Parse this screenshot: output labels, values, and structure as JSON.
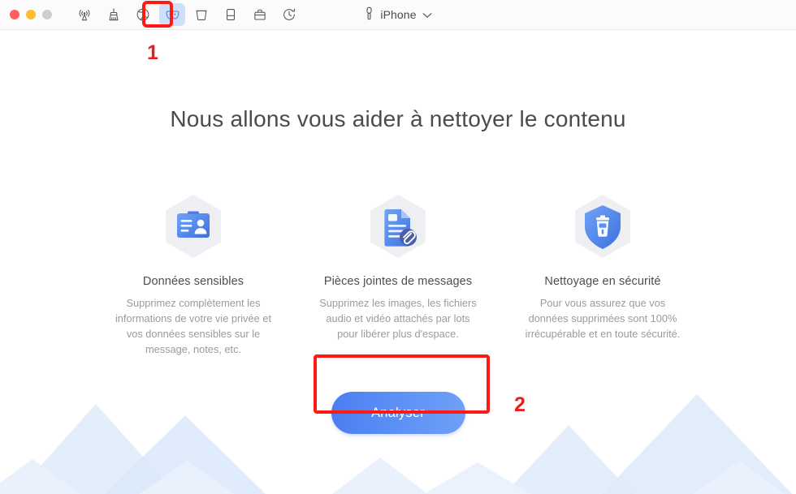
{
  "window": {
    "traffic_lights": [
      {
        "name": "close",
        "color": "#ff5f57"
      },
      {
        "name": "minimize",
        "color": "#febc2e"
      },
      {
        "name": "zoom",
        "color": "#cfcfcf"
      }
    ],
    "toolbar": {
      "items": [
        {
          "icon": "airdrop-transfer-icon",
          "label": "Transfert",
          "active": false
        },
        {
          "icon": "broom-cleaner-icon",
          "label": "Nettoyage",
          "active": false
        },
        {
          "icon": "globe-eraser-icon",
          "label": "Effacement",
          "active": false
        },
        {
          "icon": "privacy-mask-icon",
          "label": "Confidentialite",
          "active": true
        },
        {
          "icon": "bucket-trash-icon",
          "label": "Corbeille",
          "active": false
        },
        {
          "icon": "device-book-icon",
          "label": "Appareil",
          "active": false
        },
        {
          "icon": "toolkit-case-icon",
          "label": "Boite a outils",
          "active": false
        },
        {
          "icon": "clock-history-icon",
          "label": "Historique",
          "active": false
        }
      ]
    },
    "device": {
      "icon": "lightning-connector-icon",
      "name": "iPhone",
      "chevron": "chevron-down-icon"
    }
  },
  "main": {
    "headline": "Nous allons vous aider à nettoyer le contenu",
    "cards": [
      {
        "icon": "id-card-person-icon",
        "title": "Données sensibles",
        "desc": "Supprimez complètement les informations de votre vie privée et vos données sensibles sur le message, notes, etc."
      },
      {
        "icon": "document-paperclip-icon",
        "title": "Pièces jointes de messages",
        "desc": "Supprimez les images, les fichiers audio et vidéo attachés par lots pour libérer plus d'espace."
      },
      {
        "icon": "shield-trash-icon",
        "title": "Nettoyage en sécurité",
        "desc": "Pour vous assurez que vos données supprimées sont 100% irrécupérable et en toute sécurité."
      }
    ],
    "cta": {
      "label": "Analyser"
    }
  },
  "annotations": {
    "step_one": "1",
    "step_two": "2",
    "highlight_color": "#ff1a14"
  }
}
